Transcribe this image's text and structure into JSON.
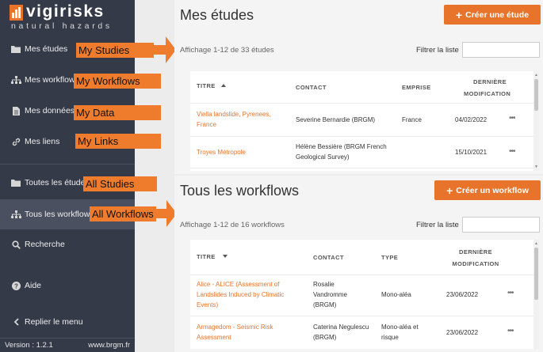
{
  "sidebar": {
    "logo_word": "vigirisks",
    "logo_sub": "natural hazards",
    "items": [
      {
        "label": "Mes études",
        "icon": "folder-icon"
      },
      {
        "label": "Mes workflows",
        "icon": "sitemap-icon"
      },
      {
        "label": "Mes données",
        "icon": "file-icon"
      },
      {
        "label": "Mes liens",
        "icon": "link-icon"
      },
      {
        "label": "Toutes les études",
        "icon": "folder-icon"
      },
      {
        "label": "Tous les workflows",
        "icon": "sitemap-icon"
      },
      {
        "label": "Recherche",
        "icon": "search-icon"
      },
      {
        "label": "Aide",
        "icon": "help-icon"
      },
      {
        "label": "Replier le menu",
        "icon": "chevron-left-icon"
      }
    ],
    "active_index": 5,
    "version": "Version : 1.2.1",
    "site": "www.brgm.fr"
  },
  "annotations": [
    "My Studies",
    "My Workflows",
    "My Data",
    "My Links",
    "All Studies",
    "All Workflows"
  ],
  "colors": {
    "accent": "#e8732a",
    "sidebar_bg": "#353a48",
    "annotation": "#ee7c2c"
  },
  "studies": {
    "title": "Mes études",
    "create_label": "Créer une étude",
    "count_text": "Affichage 1-12 de 33 études",
    "filter_label": "Filtrer la liste",
    "columns": {
      "title": "TITRE",
      "contact": "CONTACT",
      "extent": "EMPRISE",
      "modified_1": "DERNIÈRE",
      "modified_2": "MODIFICATION"
    },
    "rows": [
      {
        "title_1": "Viella landslide, Pyrenees,",
        "title_2": "France",
        "contact": "Severine Bernardie (BRGM)",
        "extent": "France",
        "date": "04/02/2022"
      },
      {
        "title_1": "Troyes Métropole",
        "title_2": "",
        "contact_1": "Hélène Bessière (BRGM French",
        "contact_2": "Geological Survey)",
        "extent": "",
        "date": "15/10/2021"
      }
    ]
  },
  "workflows": {
    "title": "Tous les workflows",
    "create_label": "Créer un workflow",
    "count_text": "Affichage 1-12 de 16 workflows",
    "filter_label": "Filtrer la liste",
    "columns": {
      "title": "TITRE",
      "contact": "CONTACT",
      "type": "TYPE",
      "modified_1": "DERNIÈRE",
      "modified_2": "MODIFICATION"
    },
    "rows": [
      {
        "title_1": "Alice - ALICE (Assessment of",
        "title_2": "Landslides Induced by Climatic",
        "title_3": "Events)",
        "contact_1": "Rosalie",
        "contact_2": "Vandromme",
        "contact_3": "(BRGM)",
        "type": "Mono-aléa",
        "date": "23/06/2022"
      },
      {
        "title_1": "Armagedom - Seismic Risk",
        "title_2": "Assessment",
        "contact_1": "Caterina Negulescu",
        "contact_2": "(BRGM)",
        "type_1": "Mono-aléa et",
        "type_2": "risque",
        "date": "23/06/2022"
      }
    ]
  }
}
